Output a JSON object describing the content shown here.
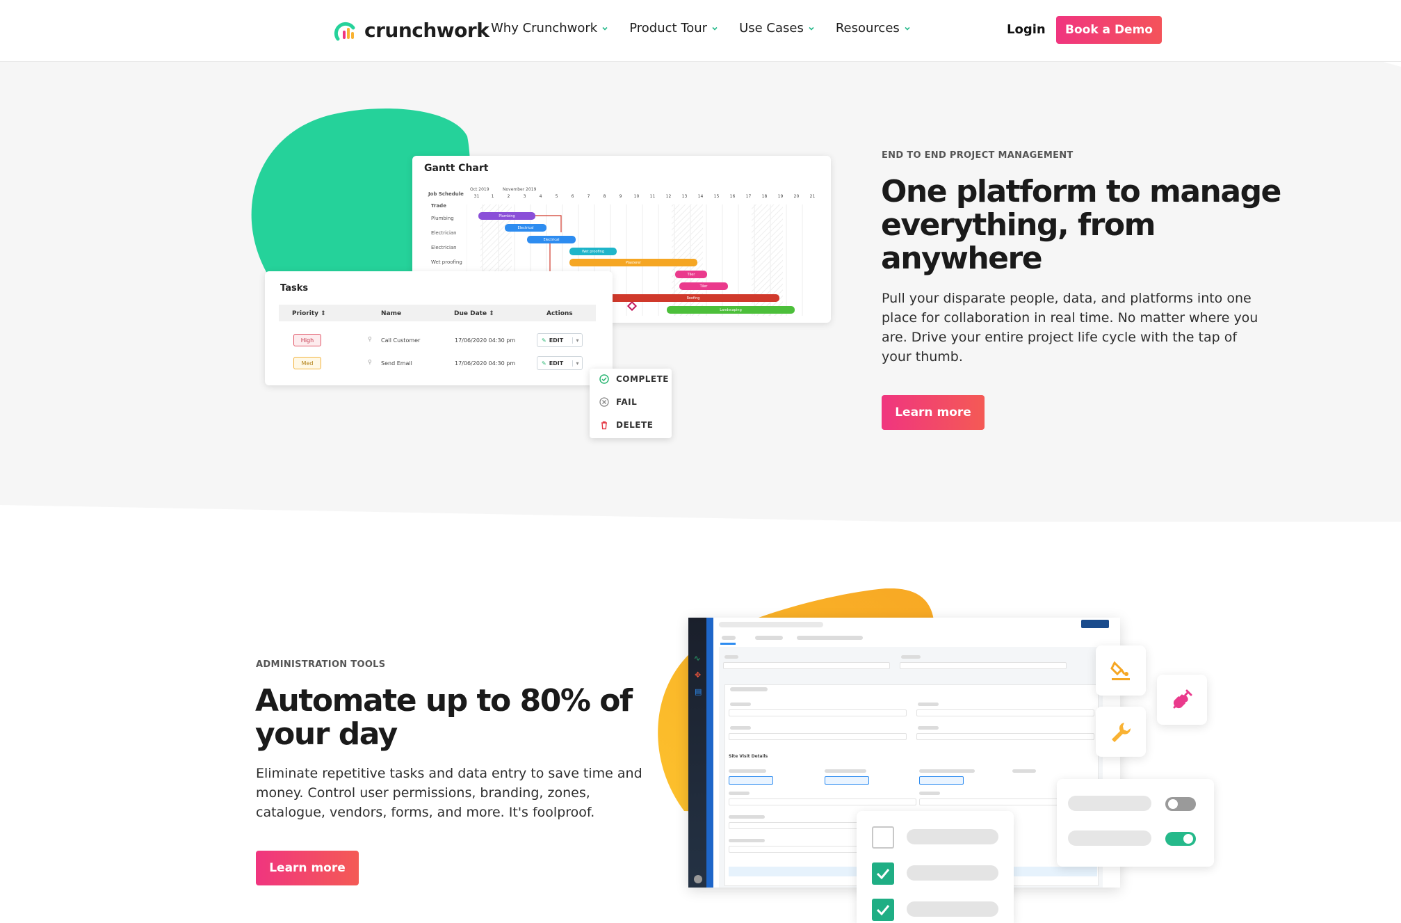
{
  "nav": {
    "logo_text": "crunchwork",
    "items": [
      {
        "label": "Why Crunchwork"
      },
      {
        "label": "Product Tour"
      },
      {
        "label": "Use Cases"
      },
      {
        "label": "Resources"
      }
    ],
    "login": "Login",
    "demo": "Book a Demo"
  },
  "section1": {
    "eyebrow": "END TO END PROJECT MANAGEMENT",
    "headline_lines": [
      "One platform to manage",
      "everything, from",
      "anywhere"
    ],
    "body_lines": [
      "Pull your disparate people, data, and platforms into one",
      "place for collaboration in real time. No matter where you",
      "are. Drive your entire project life cycle with the tap of",
      "your thumb."
    ],
    "cta": "Learn more",
    "gantt": {
      "title": "Gantt Chart",
      "col_job": "Job Schedule",
      "col_trade": "Trade",
      "month1": "Oct 2019",
      "month2": "November 2019",
      "days": [
        "31",
        "1",
        "2",
        "3",
        "4",
        "5",
        "6",
        "7",
        "8",
        "9",
        "10",
        "11",
        "12",
        "13",
        "14",
        "15",
        "16",
        "17",
        "18",
        "19",
        "20",
        "21"
      ],
      "rows": [
        "Plumbing",
        "Electrician",
        "Electrician",
        "Wet proofing"
      ],
      "bars": [
        "Plumbing",
        "Electrical",
        "Electrical",
        "Wet proofing",
        "Plasterer",
        "Tiler",
        "Tiler",
        "Roofing",
        "Landscaping"
      ],
      "colors": {
        "purple": "#8a4fd8",
        "blue": "#2d8cf0",
        "teal": "#1fb5c9",
        "orange": "#f5a623",
        "pink": "#ea3a8c",
        "red": "#d0392b",
        "green": "#4cbf3a"
      }
    },
    "tasks": {
      "title": "Tasks",
      "headers": [
        "Priority",
        "Name",
        "Due Date",
        "Actions"
      ],
      "rows": [
        {
          "priority": "High",
          "name": "Call Customer",
          "due": "17/06/2020 04:30 pm",
          "action": "EDIT"
        },
        {
          "priority": "Med",
          "name": "Send Email",
          "due": "17/06/2020 04:30 pm",
          "action": "EDIT"
        }
      ]
    },
    "action_menu": [
      "COMPLETE",
      "FAIL",
      "DELETE"
    ]
  },
  "section2": {
    "eyebrow": "ADMINISTRATION TOOLS",
    "headline_lines": [
      "Automate up to 80% of",
      "your day"
    ],
    "body_lines": [
      "Eliminate repetitive tasks and data entry to save time and",
      "money. Control user permissions, branding, zones,",
      "catalogue, vendors, forms, and more. It's foolproof."
    ],
    "cta": "Learn more",
    "mock_label": "Site Visit Details"
  },
  "colors": {
    "brand_pink": "#f0357f",
    "brand_green": "#25d29a",
    "brand_orange": "#f9b233",
    "band_grey": "#f6f6f6"
  }
}
